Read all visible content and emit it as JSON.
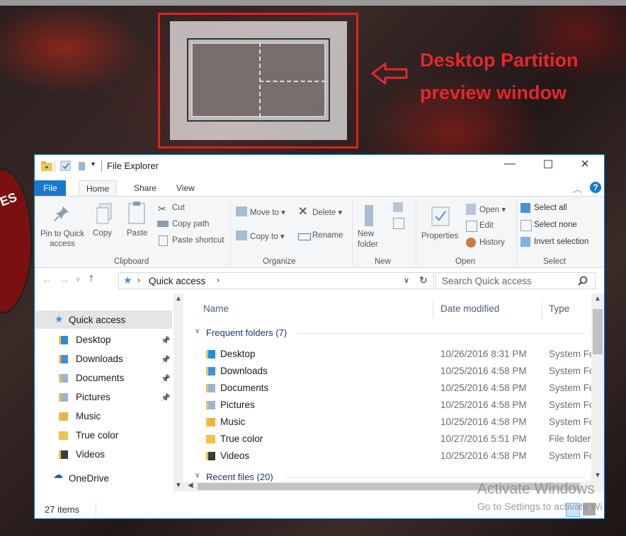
{
  "annotation": {
    "line1": "Desktop Partition",
    "line2": "preview window"
  },
  "colors": {
    "annotation_red": "#e8262a",
    "accent_blue": "#1979ca"
  },
  "explorer": {
    "title": "File Explorer",
    "tabs": {
      "file": "File",
      "home": "Home",
      "share": "Share",
      "view": "View"
    },
    "ribbon": {
      "clipboard": {
        "pin": [
          "Pin to Quick",
          "access"
        ],
        "copy": "Copy",
        "paste": "Paste",
        "cut": "Cut",
        "copy_path": "Copy path",
        "paste_shortcut": "Paste shortcut",
        "group": "Clipboard"
      },
      "organize": {
        "move_to": "Move to",
        "delete": "Delete",
        "copy_to": "Copy to",
        "rename": "Rename",
        "group": "Organize"
      },
      "new": {
        "new_folder": [
          "New",
          "folder"
        ],
        "group": "New"
      },
      "open": {
        "properties": "Properties",
        "open": "Open",
        "edit": "Edit",
        "history": "History",
        "group": "Open"
      },
      "select": {
        "select_all": "Select all",
        "select_none": "Select none",
        "invert": "Invert selection",
        "group": "Select"
      }
    },
    "address": {
      "path": "Quick access",
      "search_placeholder": "Search Quick access"
    },
    "nav": {
      "quick_access": "Quick access",
      "items": [
        {
          "label": "Desktop",
          "pinned": true
        },
        {
          "label": "Downloads",
          "pinned": true
        },
        {
          "label": "Documents",
          "pinned": true
        },
        {
          "label": "Pictures",
          "pinned": true
        },
        {
          "label": "Music",
          "pinned": false
        },
        {
          "label": "True color",
          "pinned": false
        },
        {
          "label": "Videos",
          "pinned": false
        }
      ],
      "onedrive": "OneDrive"
    },
    "columns": {
      "name": "Name",
      "date": "Date modified",
      "type": "Type"
    },
    "groups": {
      "frequent": "Frequent folders (7)",
      "recent": "Recent files (20)"
    },
    "rows": [
      {
        "name": "Desktop",
        "date": "10/26/2016 8:31 PM",
        "type": "System Fc"
      },
      {
        "name": "Downloads",
        "date": "10/25/2016 4:58 PM",
        "type": "System Fc"
      },
      {
        "name": "Documents",
        "date": "10/25/2016 4:58 PM",
        "type": "System Fc"
      },
      {
        "name": "Pictures",
        "date": "10/25/2016 4:58 PM",
        "type": "System Fc"
      },
      {
        "name": "Music",
        "date": "10/25/2016 4:58 PM",
        "type": "System Fc"
      },
      {
        "name": "True color",
        "date": "10/27/2016 5:51 PM",
        "type": "File folder"
      },
      {
        "name": "Videos",
        "date": "10/25/2016 4:58 PM",
        "type": "System Fc"
      }
    ],
    "status": {
      "items": "27 items"
    }
  },
  "watermark": {
    "line1": "Activate Windows",
    "line2": "Go to Settings to activate Wi"
  }
}
